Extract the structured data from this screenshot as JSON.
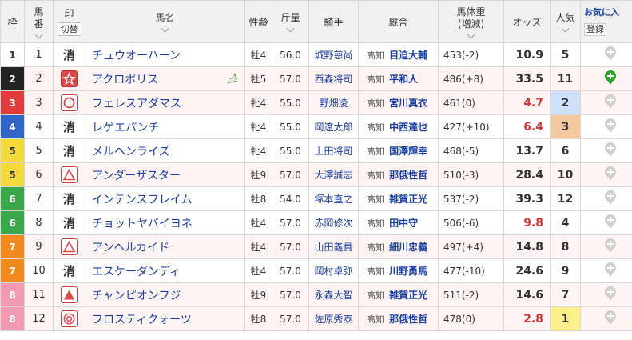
{
  "header": {
    "waku": "枠",
    "umaban": "馬\n番",
    "umaban_l1": "馬",
    "umaban_l2": "番",
    "mark": "印",
    "mark_toggle": "切替",
    "name": "馬名",
    "sexage": "性齢",
    "kinryo": "斤量",
    "jockey": "騎手",
    "stable": "厩舎",
    "bodyweight_l1": "馬体重",
    "bodyweight_l2": "(増減)",
    "odds": "オッズ",
    "pop_l1": "人気",
    "fav_title": "お気に入",
    "fav_register": "登録"
  },
  "colors": {
    "waku_1": "#ffffff",
    "waku_2": "#222222",
    "waku_3": "#e33b3b",
    "waku_4": "#2f66c8",
    "waku_5": "#f3d93a",
    "waku_6": "#3aa84a",
    "waku_7": "#f08a1d",
    "waku_8": "#f29bb0"
  },
  "rows": [
    {
      "waku": "1",
      "umaban": "1",
      "mark": "消",
      "name": "チュウオーハーン",
      "sexage": "牡4",
      "kinryo": "56.0",
      "jockey": "城野慈尚",
      "pref": "高知",
      "trainer": "目迫大輔",
      "bodyw": "453(-2)",
      "odds": "10.9",
      "odds_red": false,
      "pop": "5",
      "fav_on": false,
      "row_fav": false
    },
    {
      "waku": "2",
      "umaban": "2",
      "mark": "☆",
      "name": "アクロポリス",
      "sexage": "牡5",
      "kinryo": "57.0",
      "jockey": "西森将司",
      "pref": "高知",
      "trainer": "平和人",
      "bodyw": "486(+8)",
      "odds": "33.5",
      "odds_red": false,
      "pop": "11",
      "fav_on": true,
      "row_fav": true
    },
    {
      "waku": "3",
      "umaban": "3",
      "mark": "◯",
      "name": "フェレスアダマス",
      "sexage": "牝4",
      "kinryo": "55.0",
      "jockey": "野畑凌",
      "pref": "高知",
      "trainer": "宮川真衣",
      "bodyw": "461(0)",
      "odds": "4.7",
      "odds_red": true,
      "pop": "2",
      "fav_on": false,
      "row_fav": true
    },
    {
      "waku": "4",
      "umaban": "4",
      "mark": "消",
      "name": "レゲエパンチ",
      "sexage": "牝4",
      "kinryo": "55.0",
      "jockey": "岡遼太郎",
      "pref": "高知",
      "trainer": "中西達也",
      "bodyw": "427(+10)",
      "odds": "6.4",
      "odds_red": true,
      "pop": "3",
      "fav_on": false,
      "row_fav": false
    },
    {
      "waku": "5",
      "umaban": "5",
      "mark": "消",
      "name": "メルヘンライズ",
      "sexage": "牝4",
      "kinryo": "55.0",
      "jockey": "上田将司",
      "pref": "高知",
      "trainer": "国澤輝幸",
      "bodyw": "468(-5)",
      "odds": "13.7",
      "odds_red": false,
      "pop": "6",
      "fav_on": false,
      "row_fav": false
    },
    {
      "waku": "5",
      "umaban": "6",
      "mark": "△",
      "name": "アンダーザスター",
      "sexage": "牡9",
      "kinryo": "57.0",
      "jockey": "大澤誠志",
      "pref": "高知",
      "trainer": "那俄性哲",
      "bodyw": "510(-3)",
      "odds": "28.4",
      "odds_red": false,
      "pop": "10",
      "fav_on": false,
      "row_fav": true
    },
    {
      "waku": "6",
      "umaban": "7",
      "mark": "消",
      "name": "インテンスフレイム",
      "sexage": "牡8",
      "kinryo": "54.0",
      "jockey": "塚本直之",
      "pref": "高知",
      "trainer": "雑賀正光",
      "bodyw": "537(-2)",
      "odds": "39.3",
      "odds_red": false,
      "pop": "12",
      "fav_on": false,
      "row_fav": false
    },
    {
      "waku": "6",
      "umaban": "8",
      "mark": "消",
      "name": "チョットヤバイヨネ",
      "sexage": "牡4",
      "kinryo": "57.0",
      "jockey": "赤岡修次",
      "pref": "高知",
      "trainer": "田中守",
      "bodyw": "506(-6)",
      "odds": "9.8",
      "odds_red": true,
      "pop": "4",
      "fav_on": false,
      "row_fav": false
    },
    {
      "waku": "7",
      "umaban": "9",
      "mark": "△",
      "name": "アンヘルカイド",
      "sexage": "牡4",
      "kinryo": "57.0",
      "jockey": "山田義貴",
      "pref": "高知",
      "trainer": "細川忠義",
      "bodyw": "497(+4)",
      "odds": "14.8",
      "odds_red": false,
      "pop": "8",
      "fav_on": false,
      "row_fav": true
    },
    {
      "waku": "7",
      "umaban": "10",
      "mark": "消",
      "name": "エスケーダンディ",
      "sexage": "牡4",
      "kinryo": "57.0",
      "jockey": "岡村卓弥",
      "pref": "高知",
      "trainer": "川野勇馬",
      "bodyw": "477(-10)",
      "odds": "24.6",
      "odds_red": false,
      "pop": "9",
      "fav_on": false,
      "row_fav": false
    },
    {
      "waku": "8",
      "umaban": "11",
      "mark": "▲",
      "name": "チャンピオンフジ",
      "sexage": "牡9",
      "kinryo": "57.0",
      "jockey": "永森大智",
      "pref": "高知",
      "trainer": "雑賀正光",
      "bodyw": "511(-2)",
      "odds": "14.6",
      "odds_red": false,
      "pop": "7",
      "fav_on": false,
      "row_fav": true
    },
    {
      "waku": "8",
      "umaban": "12",
      "mark": "◎",
      "name": "フロスティクォーツ",
      "sexage": "牡8",
      "kinryo": "57.0",
      "jockey": "佐原秀泰",
      "pref": "高知",
      "trainer": "那俄性哲",
      "bodyw": "478(0)",
      "odds": "2.8",
      "odds_red": true,
      "pop": "1",
      "fav_on": false,
      "row_fav": true
    }
  ]
}
